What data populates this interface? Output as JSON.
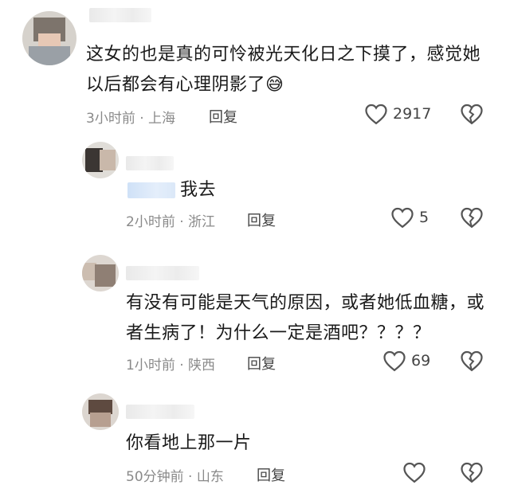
{
  "comments": [
    {
      "text_line1": "这女的也是真的可怜被光天化日之下摸了，感觉她",
      "text_line2": "以后都会有心理阴影了",
      "emoji": "😅",
      "time": "3小时前",
      "location": "上海",
      "reply_label": "回复",
      "likes": "2917"
    },
    {
      "text": "我去",
      "time": "2小时前",
      "location": "浙江",
      "reply_label": "回复",
      "likes": "5"
    },
    {
      "text_line1": "有没有可能是天气的原因，或者她低血糖，或",
      "text_line2": "者生病了！为什么一定是酒吧？？？？",
      "time": "1小时前",
      "location": "陕西",
      "reply_label": "回复",
      "likes": "69"
    },
    {
      "text": "你看地上那一片",
      "time": "50分钟前",
      "location": "山东",
      "reply_label": "回复",
      "likes": ""
    }
  ],
  "separator": "·",
  "icons": {
    "like": "heart-outline-icon",
    "dislike": "broken-heart-icon"
  }
}
